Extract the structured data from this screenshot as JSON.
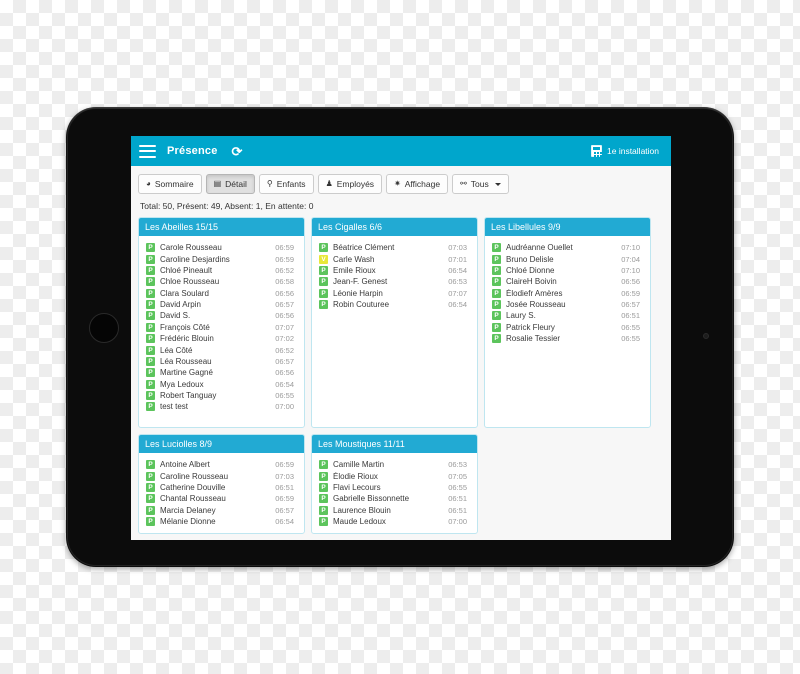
{
  "header": {
    "menu_icon": "hamburger-menu-icon",
    "title": "Présence",
    "refresh_icon": "refresh-icon",
    "installation_icon": "building-icon",
    "installation_label": "1e installation",
    "background_color": "#00a6cc"
  },
  "toolbar": {
    "buttons": [
      {
        "label": "Sommaire",
        "icon": "pie-chart-icon",
        "glyph": "◕",
        "active": false
      },
      {
        "label": "Détail",
        "icon": "list-icon",
        "glyph": "▤",
        "active": true
      },
      {
        "label": "Enfants",
        "icon": "child-icon",
        "glyph": "⚲",
        "active": false
      },
      {
        "label": "Employés",
        "icon": "user-icon",
        "glyph": "♟",
        "active": false
      },
      {
        "label": "Affichage",
        "icon": "gear-icon",
        "glyph": "✷",
        "active": false
      },
      {
        "label": "Tous",
        "icon": "group-icon",
        "glyph": "⚯",
        "active": false,
        "has_caret": true
      }
    ]
  },
  "summary": {
    "text": "Total: 50, Présent: 49, Absent: 1, En attente: 0",
    "total": 50,
    "present": 49,
    "absent": 1,
    "waiting": 0
  },
  "status_colors": {
    "present": "#5cc45c",
    "waiting": "#e8e83a",
    "panel_header": "#22aad3",
    "accent": "#00a6cc"
  },
  "panels": [
    {
      "title": "Les Abeilles 15/15",
      "size": "tall",
      "rows": [
        {
          "badge": "P",
          "status": "present",
          "name": "Carole Rousseau",
          "time": "06:59"
        },
        {
          "badge": "P",
          "status": "present",
          "name": "Caroline Desjardins",
          "time": "06:59"
        },
        {
          "badge": "P",
          "status": "present",
          "name": "Chloé Pineault",
          "time": "06:52"
        },
        {
          "badge": "P",
          "status": "present",
          "name": "Chloe Rousseau",
          "time": "06:58"
        },
        {
          "badge": "P",
          "status": "present",
          "name": "Clara Soulard",
          "time": "06:56"
        },
        {
          "badge": "P",
          "status": "present",
          "name": "David Arpin",
          "time": "06:57"
        },
        {
          "badge": "P",
          "status": "present",
          "name": "David S.",
          "time": "06:56"
        },
        {
          "badge": "P",
          "status": "present",
          "name": "François Côté",
          "time": "07:07"
        },
        {
          "badge": "P",
          "status": "present",
          "name": "Frédéric Blouin",
          "time": "07:02"
        },
        {
          "badge": "P",
          "status": "present",
          "name": "Léa Côté",
          "time": "06:52"
        },
        {
          "badge": "P",
          "status": "present",
          "name": "Léa Rousseau",
          "time": "06:57"
        },
        {
          "badge": "P",
          "status": "present",
          "name": "Martine Gagné",
          "time": "06:56"
        },
        {
          "badge": "P",
          "status": "present",
          "name": "Mya Ledoux",
          "time": "06:54"
        },
        {
          "badge": "P",
          "status": "present",
          "name": "Robert Tanguay",
          "time": "06:55"
        },
        {
          "badge": "P",
          "status": "present",
          "name": "test test",
          "time": "07:00"
        }
      ]
    },
    {
      "title": "Les Cigalles 6/6",
      "size": "tall",
      "rows": [
        {
          "badge": "P",
          "status": "present",
          "name": "Béatrice Clément",
          "time": "07:03"
        },
        {
          "badge": "V",
          "status": "waiting",
          "name": "Carle Wash",
          "time": "07:01"
        },
        {
          "badge": "P",
          "status": "present",
          "name": "Emile Rioux",
          "time": "06:54"
        },
        {
          "badge": "P",
          "status": "present",
          "name": "Jean-F. Genest",
          "time": "06:53"
        },
        {
          "badge": "P",
          "status": "present",
          "name": "Léonie Harpin",
          "time": "07:07"
        },
        {
          "badge": "P",
          "status": "present",
          "name": "Robin Couturee",
          "time": "06:54"
        }
      ]
    },
    {
      "title": "Les Libellules 9/9",
      "size": "tall",
      "rows": [
        {
          "badge": "P",
          "status": "present",
          "name": "Audréanne Ouellet",
          "time": "07:10"
        },
        {
          "badge": "P",
          "status": "present",
          "name": "Bruno Delisle",
          "time": "07:04"
        },
        {
          "badge": "P",
          "status": "present",
          "name": "Chloé Dionne",
          "time": "07:10"
        },
        {
          "badge": "P",
          "status": "present",
          "name": "ClaireH Boivin",
          "time": "06:56"
        },
        {
          "badge": "P",
          "status": "present",
          "name": "Élodiefr Amères",
          "time": "06:59"
        },
        {
          "badge": "P",
          "status": "present",
          "name": "Josée Rousseau",
          "time": "06:57"
        },
        {
          "badge": "P",
          "status": "present",
          "name": "Laury S.",
          "time": "06:51"
        },
        {
          "badge": "P",
          "status": "present",
          "name": "Patrick Fleury",
          "time": "06:55"
        },
        {
          "badge": "P",
          "status": "present",
          "name": "Rosalie Tessier",
          "time": "06:55"
        }
      ]
    },
    {
      "title": "Les Luciolles 8/9",
      "size": "short",
      "rows": [
        {
          "badge": "P",
          "status": "present",
          "name": "Antoine Albert",
          "time": "06:59"
        },
        {
          "badge": "P",
          "status": "present",
          "name": "Caroline Rousseau",
          "time": "07:03"
        },
        {
          "badge": "P",
          "status": "present",
          "name": "Catherine Douville",
          "time": "06:51"
        },
        {
          "badge": "P",
          "status": "present",
          "name": "Chantal Rousseau",
          "time": "06:59"
        },
        {
          "badge": "P",
          "status": "present",
          "name": "Marcia Delaney",
          "time": "06:57"
        },
        {
          "badge": "P",
          "status": "present",
          "name": "Mélanie Dionne",
          "time": "06:54"
        }
      ]
    },
    {
      "title": "Les Moustiques 11/11",
      "size": "short",
      "rows": [
        {
          "badge": "P",
          "status": "present",
          "name": "Camille Martin",
          "time": "06:53"
        },
        {
          "badge": "P",
          "status": "present",
          "name": "Élodie Rioux",
          "time": "07:05"
        },
        {
          "badge": "P",
          "status": "present",
          "name": "Flavi Lecours",
          "time": "06:55"
        },
        {
          "badge": "P",
          "status": "present",
          "name": "Gabrielle Bissonnette",
          "time": "06:51"
        },
        {
          "badge": "P",
          "status": "present",
          "name": "Laurence Blouin",
          "time": "06:51"
        },
        {
          "badge": "P",
          "status": "present",
          "name": "Maude Ledoux",
          "time": "07:00"
        }
      ]
    }
  ]
}
